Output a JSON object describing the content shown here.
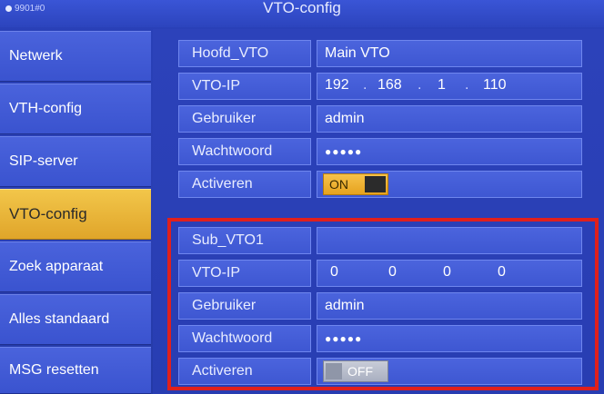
{
  "titlebar": {
    "device_id": "9901#0",
    "title": "VTO-config"
  },
  "sidebar": {
    "items": [
      {
        "label": "Netwerk"
      },
      {
        "label": "VTH-config"
      },
      {
        "label": "SIP-server"
      },
      {
        "label": "VTO-config",
        "active": true
      },
      {
        "label": "Zoek apparaat"
      },
      {
        "label": "Alles standaard"
      },
      {
        "label": "MSG resetten"
      }
    ]
  },
  "main_vto": {
    "name_label": "Hoofd_VTO",
    "name_value": "Main VTO",
    "ip_label": "VTO-IP",
    "ip": [
      "192",
      "168",
      "1",
      "110"
    ],
    "user_label": "Gebruiker",
    "user_value": "admin",
    "pwd_label": "Wachtwoord",
    "pwd_value": "●●●●●",
    "enable_label": "Activeren",
    "enable_state": "ON"
  },
  "sub_vto": {
    "name_label": "Sub_VTO1",
    "name_value": "",
    "ip_label": "VTO-IP",
    "ip": [
      "0",
      "0",
      "0",
      "0"
    ],
    "user_label": "Gebruiker",
    "user_value": "admin",
    "pwd_label": "Wachtwoord",
    "pwd_value": "●●●●●",
    "enable_label": "Activeren",
    "enable_state": "OFF"
  },
  "colors": {
    "accent_active": "#f2c64a",
    "panel": "#3e57d2",
    "highlight": "#e0201c"
  },
  "icons": {
    "device": "location-pin-icon"
  }
}
